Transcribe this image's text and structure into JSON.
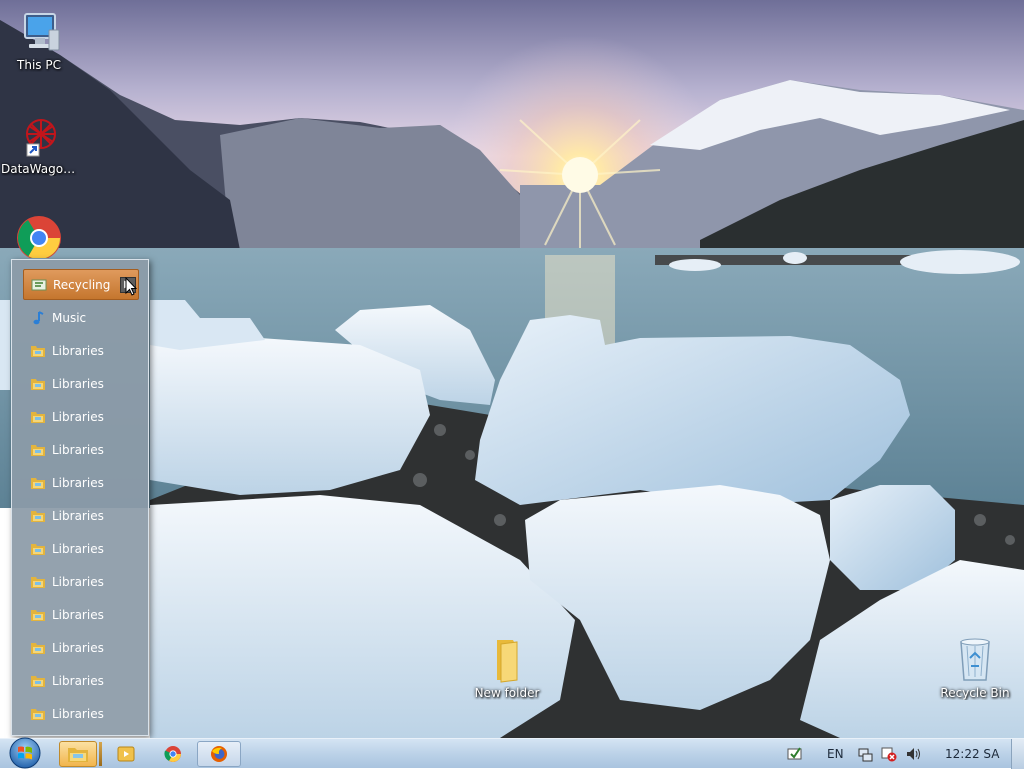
{
  "desktop": {
    "icons": [
      {
        "label": "This PC",
        "icon": "computer-icon"
      },
      {
        "label": "DataWagon...",
        "icon": "datawagon-shortcut-icon"
      },
      {
        "label": "",
        "icon": "chrome-shortcut-icon"
      },
      {
        "label": "New folder",
        "icon": "folder-icon"
      },
      {
        "label": "Recycle Bin",
        "icon": "recycle-bin-icon"
      }
    ]
  },
  "jump_menu": {
    "items": [
      {
        "label": "Recycling",
        "icon": "recycling-icon",
        "selected": true
      },
      {
        "label": "Music",
        "icon": "music-note-icon"
      },
      {
        "label": "Libraries",
        "icon": "library-folder-icon"
      },
      {
        "label": "Libraries",
        "icon": "library-folder-icon"
      },
      {
        "label": "Libraries",
        "icon": "library-folder-icon"
      },
      {
        "label": "Libraries",
        "icon": "library-folder-icon"
      },
      {
        "label": "Libraries",
        "icon": "library-folder-icon"
      },
      {
        "label": "Libraries",
        "icon": "library-folder-icon"
      },
      {
        "label": "Libraries",
        "icon": "library-folder-icon"
      },
      {
        "label": "Libraries",
        "icon": "library-folder-icon"
      },
      {
        "label": "Libraries",
        "icon": "library-folder-icon"
      },
      {
        "label": "Libraries",
        "icon": "library-folder-icon"
      },
      {
        "label": "Libraries",
        "icon": "library-folder-icon"
      },
      {
        "label": "Libraries",
        "icon": "library-folder-icon"
      }
    ],
    "submenu_arrow": "▶"
  },
  "taskbar": {
    "start_icon": "windows-start-orb-icon",
    "pinned": [
      {
        "icon": "file-explorer-icon",
        "state": "active"
      },
      {
        "icon": "media-player-icon",
        "state": "idle"
      },
      {
        "icon": "chrome-icon",
        "state": "idle"
      },
      {
        "icon": "firefox-icon",
        "state": "open"
      }
    ],
    "tray": {
      "language": "EN",
      "clock": "12:22 SA"
    }
  },
  "colors": {
    "selected_item": "#d48843",
    "menu_bg": "#8c9ba8",
    "taskbar": "#bcd2e8"
  }
}
